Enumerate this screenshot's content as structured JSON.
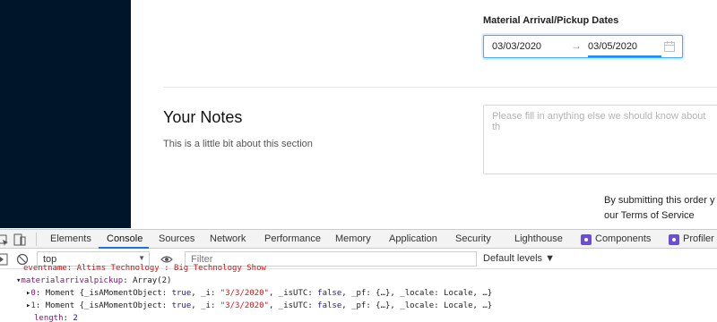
{
  "form": {
    "dates_label": "Material Arrival/Pickup Dates",
    "range_start": "03/03/2020",
    "range_separator": "→",
    "range_end": "03/05/2020",
    "notes_title": "Your Notes",
    "notes_description": "This is a little bit about this section",
    "notes_placeholder": "Please fill in anything else we should know about th",
    "submit_line1": "By submitting this order y",
    "submit_line2": "our Terms of Service"
  },
  "colors": {
    "sidebar": "#001529",
    "accent": "#1890ff",
    "devtools_active": "#1a73e8"
  },
  "devtools": {
    "tabs": [
      {
        "label": "Elements"
      },
      {
        "label": "Console"
      },
      {
        "label": "Sources"
      },
      {
        "label": "Network"
      },
      {
        "label": "Performance"
      },
      {
        "label": "Memory"
      },
      {
        "label": "Application"
      },
      {
        "label": "Security"
      },
      {
        "label": "Lighthouse"
      },
      {
        "label": "Components"
      },
      {
        "label": "Profiler"
      }
    ],
    "active_tab": "Console",
    "context": "top",
    "filter_placeholder": "Filter",
    "levels_label": "Default levels ▼",
    "console": {
      "cut_line": "eventname: Altims Technology : Big Technology Show",
      "array_key": "materialarrivalpickup",
      "array_value": "Array(2)",
      "item0_index": "0",
      "item1_index": "1",
      "moment_prefix": "Moment {_isAMomentObject: ",
      "true_text": "true",
      "i_key": ", _i: ",
      "i_value": "\"3/3/2020\"",
      "isutc_key": ", _isUTC: ",
      "false_text": "false",
      "rest": ", _pf: {…}, _locale: Locale, …}",
      "length_key": "length",
      "length_value": "2"
    }
  }
}
